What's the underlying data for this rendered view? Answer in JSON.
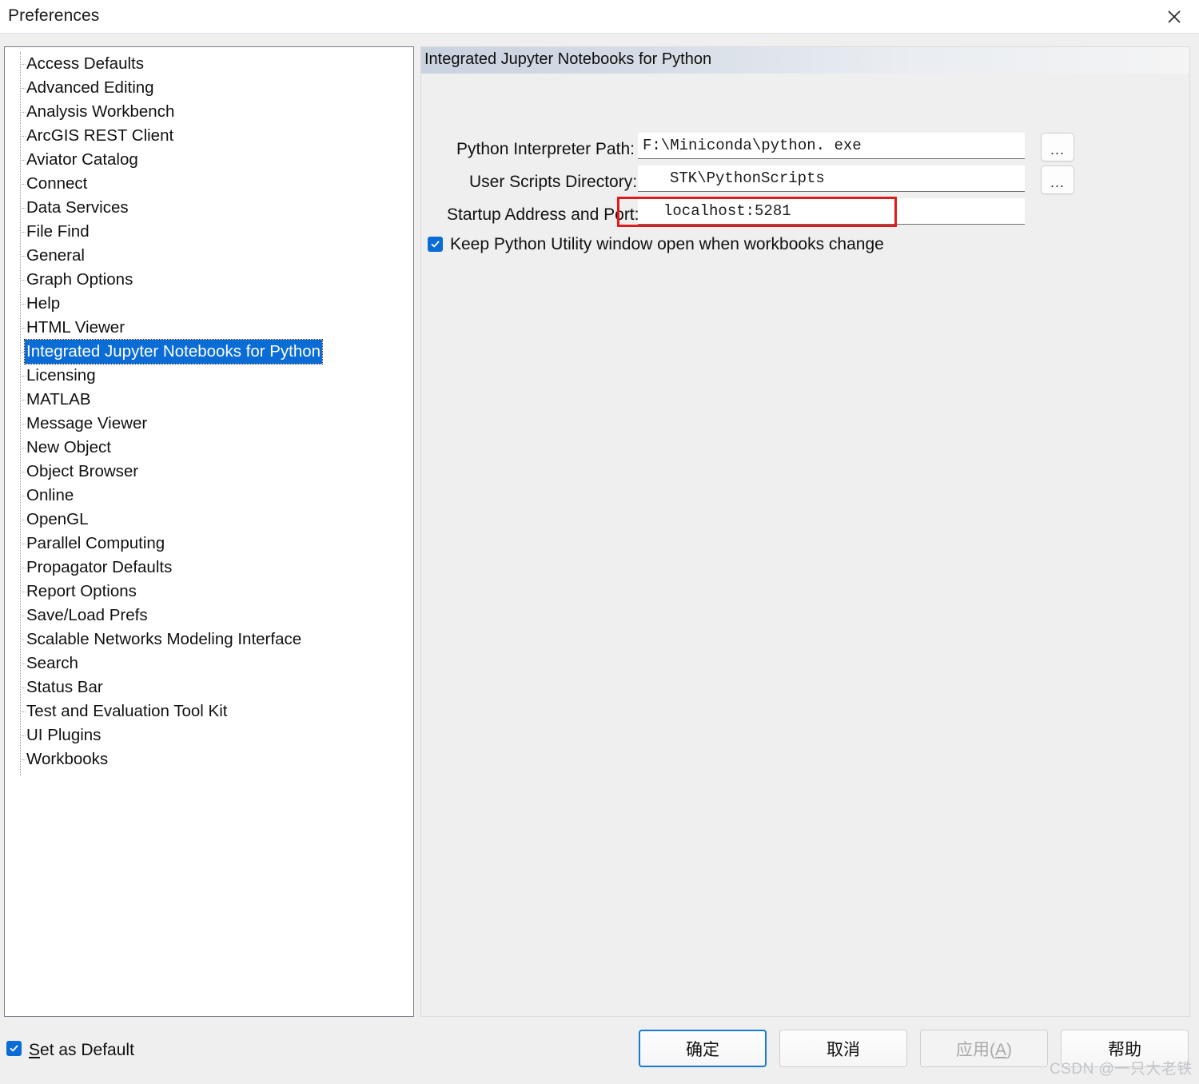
{
  "window": {
    "title": "Preferences",
    "close_icon": "close-icon"
  },
  "tree": {
    "items": [
      {
        "label": "Access Defaults",
        "selected": false
      },
      {
        "label": "Advanced Editing",
        "selected": false
      },
      {
        "label": "Analysis Workbench",
        "selected": false
      },
      {
        "label": "ArcGIS REST Client",
        "selected": false
      },
      {
        "label": "Aviator Catalog",
        "selected": false
      },
      {
        "label": "Connect",
        "selected": false
      },
      {
        "label": "Data Services",
        "selected": false
      },
      {
        "label": "File Find",
        "selected": false
      },
      {
        "label": "General",
        "selected": false
      },
      {
        "label": "Graph Options",
        "selected": false
      },
      {
        "label": "Help",
        "selected": false
      },
      {
        "label": "HTML Viewer",
        "selected": false
      },
      {
        "label": "Integrated Jupyter Notebooks for Python",
        "selected": true
      },
      {
        "label": "Licensing",
        "selected": false
      },
      {
        "label": "MATLAB",
        "selected": false
      },
      {
        "label": "Message Viewer",
        "selected": false
      },
      {
        "label": "New Object",
        "selected": false
      },
      {
        "label": "Object Browser",
        "selected": false
      },
      {
        "label": "Online",
        "selected": false
      },
      {
        "label": "OpenGL",
        "selected": false
      },
      {
        "label": "Parallel Computing",
        "selected": false
      },
      {
        "label": "Propagator Defaults",
        "selected": false
      },
      {
        "label": "Report Options",
        "selected": false
      },
      {
        "label": "Save/Load Prefs",
        "selected": false
      },
      {
        "label": "Scalable Networks Modeling Interface",
        "selected": false
      },
      {
        "label": "Search",
        "selected": false
      },
      {
        "label": "Status Bar",
        "selected": false
      },
      {
        "label": "Test and Evaluation Tool Kit",
        "selected": false
      },
      {
        "label": "UI Plugins",
        "selected": false
      },
      {
        "label": "Workbooks",
        "selected": false
      }
    ],
    "selection_color": "#0a6cd4"
  },
  "panel": {
    "header": "Integrated Jupyter Notebooks for Python",
    "fields": {
      "interpreter": {
        "label": "Python Interpreter Path:",
        "value": "F:\\Miniconda\\python. exe",
        "browse_label": "..."
      },
      "scripts_dir": {
        "label": "User Scripts Directory:",
        "value": "STK\\PythonScripts",
        "browse_label": "..."
      },
      "startup": {
        "label": "Startup Address and Port:",
        "value": "localhost:5281",
        "highlight_color": "#e01b1b"
      }
    },
    "checkbox": {
      "label": "Keep Python Utility window open when workbooks change",
      "checked": true
    }
  },
  "footer": {
    "set_default": {
      "accel": "S",
      "rest": "et as Default",
      "checked": true
    },
    "buttons": {
      "ok": "确定",
      "cancel": "取消",
      "apply_text": "应用(",
      "apply_accel": "A",
      "apply_tail": ")",
      "help": "帮助"
    }
  },
  "watermark": "CSDN @一只大老铁"
}
